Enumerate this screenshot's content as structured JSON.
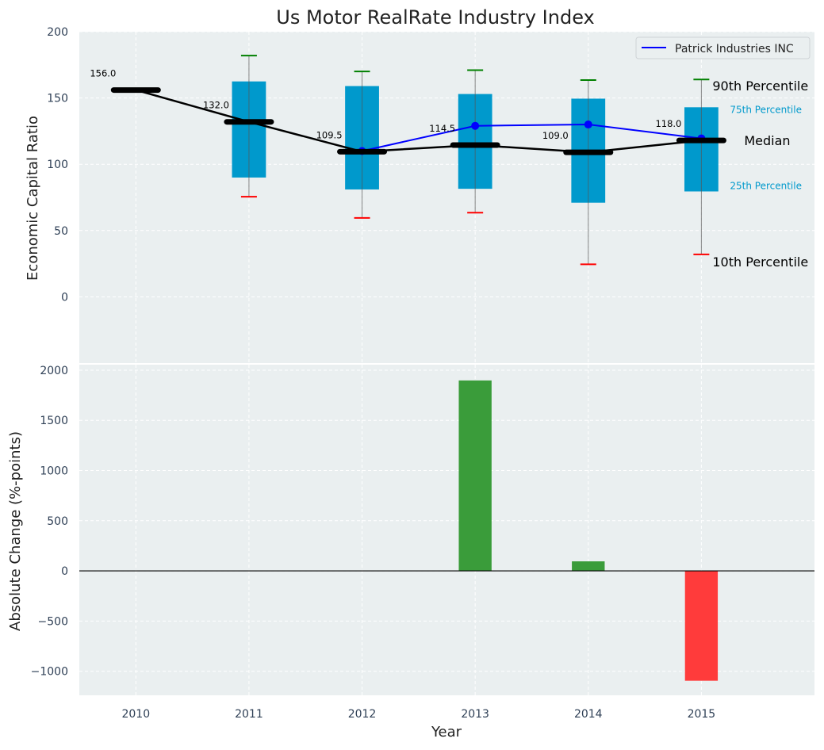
{
  "chart_data": [
    {
      "type": "box",
      "title": "Us Motor RealRate Industry Index",
      "xlabel": "",
      "ylabel": "Economic Capital Ratio",
      "ylim": [
        -50,
        200
      ],
      "xlim": [
        2009.5,
        2016
      ],
      "yticks": [
        0,
        50,
        100,
        150,
        200
      ],
      "grid": true,
      "legend": {
        "placement": "top-right",
        "entries": [
          "Patrick Industries INC"
        ]
      },
      "years": [
        2010,
        2011,
        2012,
        2013,
        2014,
        2015
      ],
      "p90": [
        null,
        182,
        170,
        171,
        163.5,
        164
      ],
      "p75": [
        null,
        162.5,
        159,
        153,
        149.5,
        143
      ],
      "median": [
        156.0,
        132.0,
        109.5,
        114.5,
        109.0,
        118.0
      ],
      "median_labels": [
        "156.0",
        "132.0",
        "109.5",
        "114.5",
        "109.0",
        "118.0"
      ],
      "p25": [
        null,
        90,
        81,
        81.5,
        71,
        79.5
      ],
      "p10": [
        null,
        75.5,
        59.5,
        63.5,
        24.5,
        32
      ],
      "series": [
        {
          "name": "Patrick Industries INC",
          "x": [
            2012,
            2013,
            2014,
            2015
          ],
          "values": [
            110,
            129,
            130,
            119.5
          ],
          "color": "#0000ff"
        }
      ],
      "annotations": {
        "p90": "90th Percentile",
        "p75": "75th Percentile",
        "median": "Median",
        "p25": "25th Percentile",
        "p10": "10th Percentile"
      },
      "colors": {
        "box": "#0099cc",
        "median": "#000000",
        "p90_cap": "#008000",
        "p10_cap": "#ff0000",
        "background": "#eaeff0"
      }
    },
    {
      "type": "bar",
      "xlabel": "Year",
      "ylabel": "Absolute Change (%-points)",
      "ylim": [
        -1240,
        2055
      ],
      "yticks": [
        -1000,
        -500,
        0,
        500,
        1000,
        1500,
        2000
      ],
      "ytick_labels": [
        "−1000",
        "−500",
        "0",
        "500",
        "1000",
        "1500",
        "2000"
      ],
      "categories": [
        "2010",
        "2011",
        "2012",
        "2013",
        "2014",
        "2015"
      ],
      "x": [
        2010,
        2011,
        2012,
        2013,
        2014,
        2015
      ],
      "values": [
        null,
        null,
        null,
        1898,
        95,
        -1095
      ],
      "colors": {
        "positive": "#3a9c3a",
        "negative": "#ff3b3b"
      },
      "grid": true
    }
  ]
}
